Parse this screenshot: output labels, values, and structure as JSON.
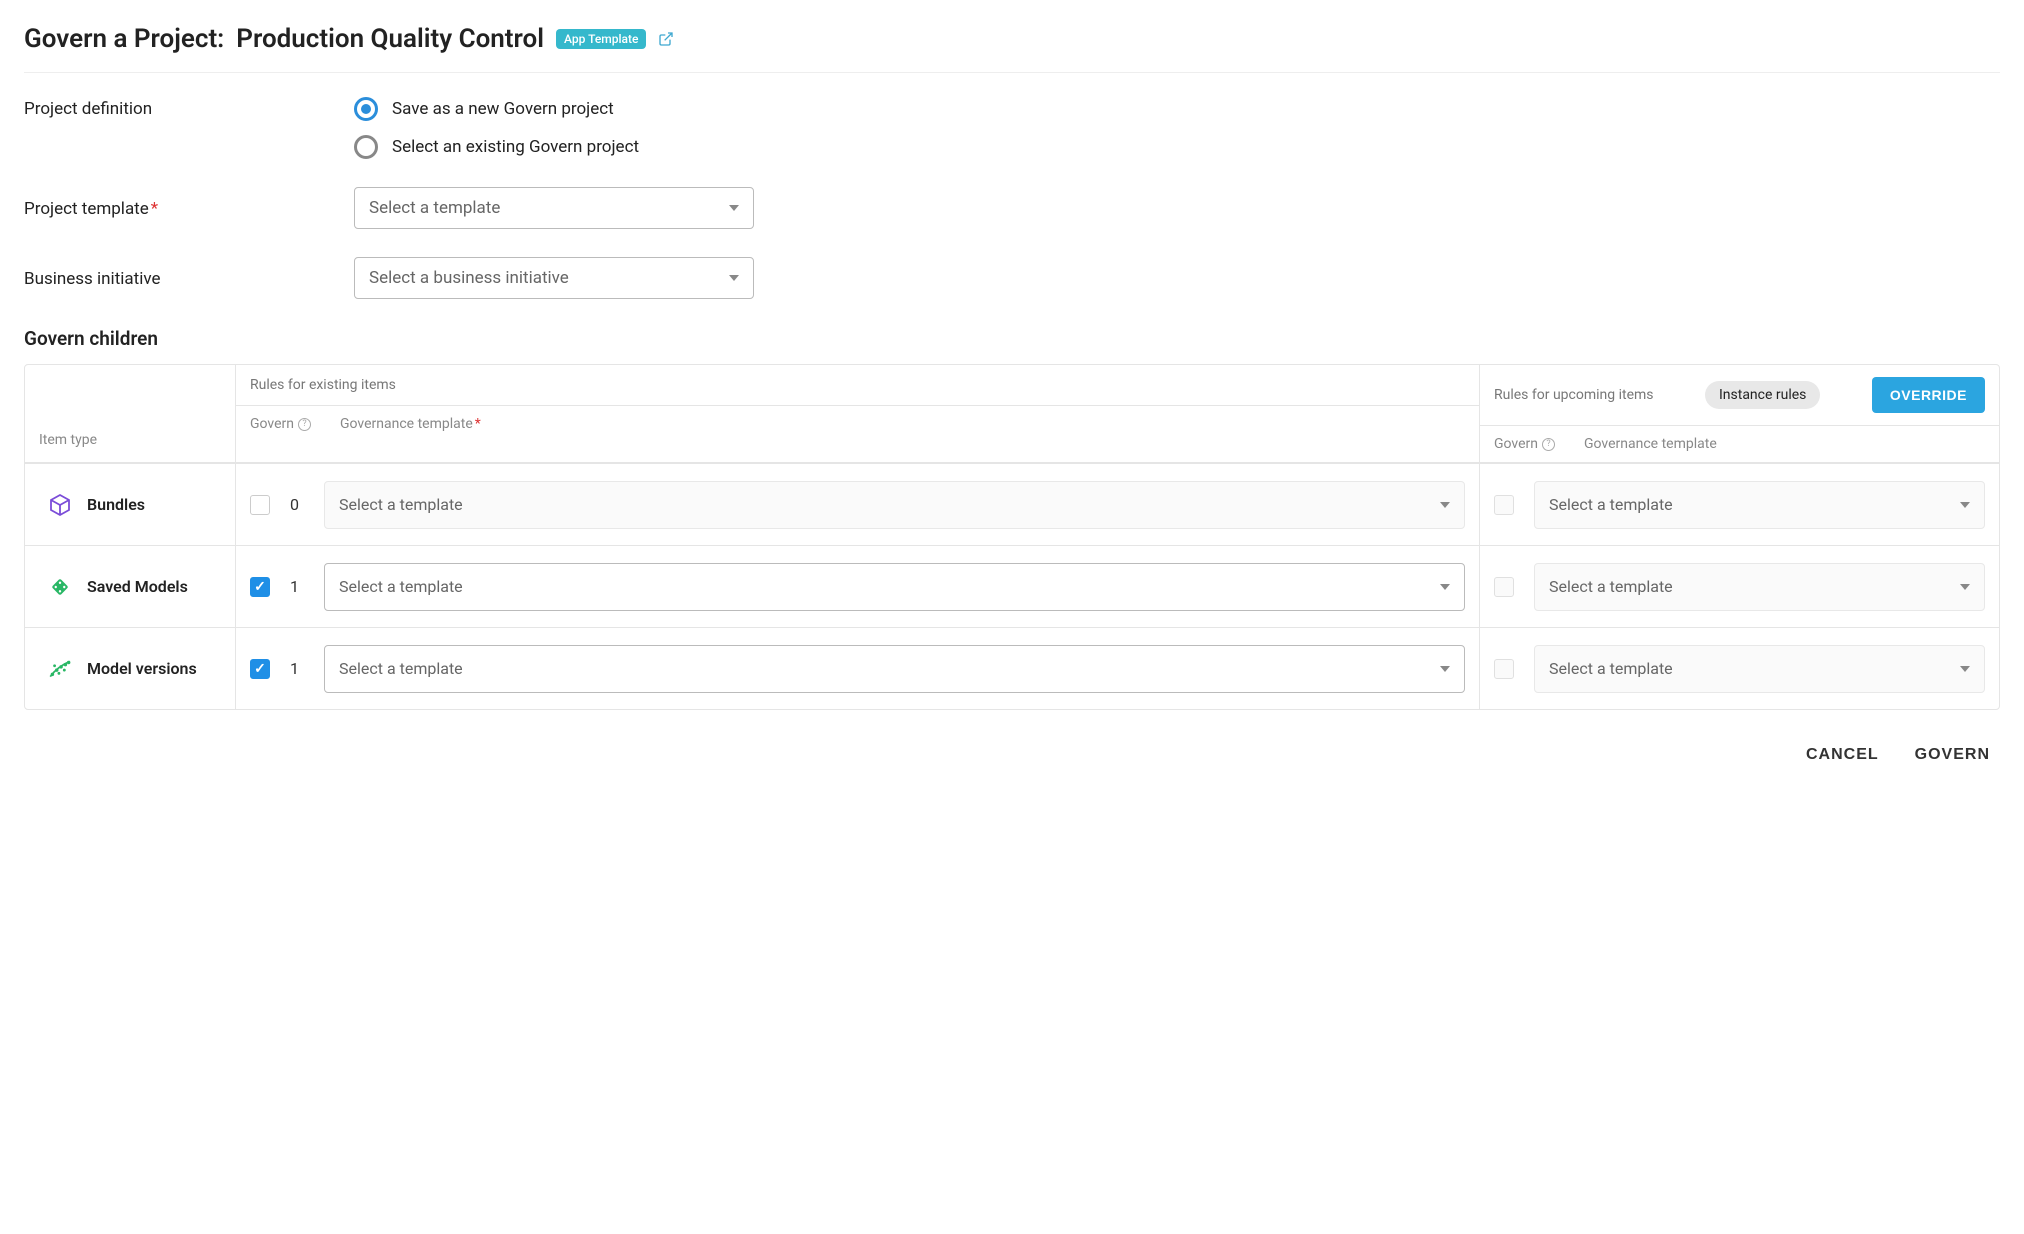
{
  "title_prefix": "Govern a Project:",
  "title_name": "Production Quality Control",
  "badge": "App Template",
  "labels": {
    "project_definition": "Project definition",
    "project_template": "Project template",
    "business_initiative": "Business initiative",
    "govern_children": "Govern children"
  },
  "radio": {
    "save_new": "Save as a new Govern project",
    "select_existing": "Select an existing Govern project"
  },
  "selects": {
    "template_placeholder": "Select a template",
    "initiative_placeholder": "Select a business initiative"
  },
  "table": {
    "headers": {
      "item_type": "Item type",
      "existing": "Rules for existing items",
      "upcoming": "Rules for upcoming items",
      "instance_rules": "Instance rules",
      "override": "OVERRIDE",
      "govern": "Govern",
      "gov_template": "Governance template"
    },
    "rows": [
      {
        "label": "Bundles",
        "checked": false,
        "count": "0",
        "icon": "cube",
        "icon_color": "#7b4cd8"
      },
      {
        "label": "Saved Models",
        "checked": true,
        "count": "1",
        "icon": "diamond",
        "icon_color": "#29b765"
      },
      {
        "label": "Model versions",
        "checked": true,
        "count": "1",
        "icon": "scatter",
        "icon_color": "#29b765"
      }
    ],
    "select_placeholder": "Select a template"
  },
  "footer": {
    "cancel": "CANCEL",
    "govern": "GOVERN"
  }
}
